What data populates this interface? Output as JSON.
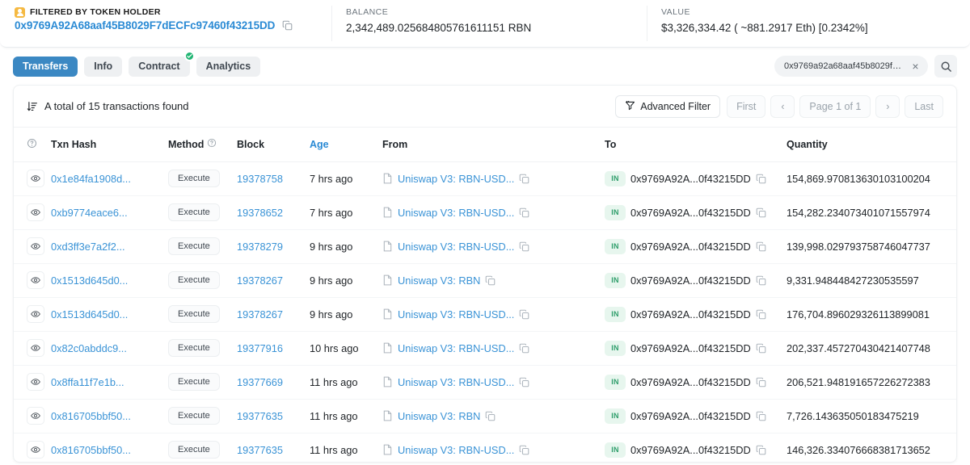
{
  "summary": {
    "filter": {
      "label": "FILTERED BY TOKEN HOLDER",
      "address": "0x9769A92A68aaf45B8029F7dECFc97460f43215DD",
      "copy_icon": "copy-icon",
      "tag_icon": "token-holder-icon"
    },
    "balance": {
      "label": "BALANCE",
      "value": "2,342,489.025684805761611151 RBN"
    },
    "value": {
      "label": "VALUE",
      "value": "$3,326,334.42 ( ~881.2917 Eth) [0.2342%]"
    }
  },
  "tabs": [
    {
      "label": "Transfers",
      "active": true,
      "verified": false
    },
    {
      "label": "Info",
      "active": false,
      "verified": false
    },
    {
      "label": "Contract",
      "active": false,
      "verified": true
    },
    {
      "label": "Analytics",
      "active": false,
      "verified": false
    }
  ],
  "search": {
    "value": "0x9769a92a68aaf45b8029f7d...",
    "placeholder": "Search",
    "clear_label": "×",
    "clear_icon": "close-icon",
    "search_icon": "search-icon"
  },
  "toolbar": {
    "total_text": "A total of 15 transactions found",
    "sort_icon": "sort-descending-icon",
    "advanced_filter_label": "Advanced Filter",
    "filter_icon": "funnel-icon",
    "pager": {
      "first": "First",
      "prev": "‹",
      "page": "Page 1 of 1",
      "next": "›",
      "last": "Last"
    }
  },
  "table": {
    "columns": {
      "eye": "",
      "eye_help_icon": "question-circle-icon",
      "hash": "Txn Hash",
      "method": "Method",
      "method_help_icon": "question-circle-icon",
      "block": "Block",
      "age": "Age",
      "from": "From",
      "to": "To",
      "quantity": "Quantity"
    },
    "rows": [
      {
        "eye_icon": "eye-icon",
        "hash": "0x1e84fa1908d...",
        "method": "Execute",
        "block": "19378758",
        "age": "7 hrs ago",
        "from": "Uniswap V3: RBN-USD...",
        "from_icon": "contract-icon",
        "from_copy_icon": "copy-icon",
        "direction": "IN",
        "to": "0x9769A92A...0f43215DD",
        "to_copy_icon": "copy-icon",
        "quantity": "154,869.970813630103100204"
      },
      {
        "eye_icon": "eye-icon",
        "hash": "0xb9774eace6...",
        "method": "Execute",
        "block": "19378652",
        "age": "7 hrs ago",
        "from": "Uniswap V3: RBN-USD...",
        "from_icon": "contract-icon",
        "from_copy_icon": "copy-icon",
        "direction": "IN",
        "to": "0x9769A92A...0f43215DD",
        "to_copy_icon": "copy-icon",
        "quantity": "154,282.234073401071557974"
      },
      {
        "eye_icon": "eye-icon",
        "hash": "0xd3ff3e7a2f2...",
        "method": "Execute",
        "block": "19378279",
        "age": "9 hrs ago",
        "from": "Uniswap V3: RBN-USD...",
        "from_icon": "contract-icon",
        "from_copy_icon": "copy-icon",
        "direction": "IN",
        "to": "0x9769A92A...0f43215DD",
        "to_copy_icon": "copy-icon",
        "quantity": "139,998.029793758746047737"
      },
      {
        "eye_icon": "eye-icon",
        "hash": "0x1513d645d0...",
        "method": "Execute",
        "block": "19378267",
        "age": "9 hrs ago",
        "from": "Uniswap V3: RBN",
        "from_icon": "contract-icon",
        "from_copy_icon": "copy-icon",
        "direction": "IN",
        "to": "0x9769A92A...0f43215DD",
        "to_copy_icon": "copy-icon",
        "quantity": "9,331.948448427230535597"
      },
      {
        "eye_icon": "eye-icon",
        "hash": "0x1513d645d0...",
        "method": "Execute",
        "block": "19378267",
        "age": "9 hrs ago",
        "from": "Uniswap V3: RBN-USD...",
        "from_icon": "contract-icon",
        "from_copy_icon": "copy-icon",
        "direction": "IN",
        "to": "0x9769A92A...0f43215DD",
        "to_copy_icon": "copy-icon",
        "quantity": "176,704.896029326113899081"
      },
      {
        "eye_icon": "eye-icon",
        "hash": "0x82c0abddc9...",
        "method": "Execute",
        "block": "19377916",
        "age": "10 hrs ago",
        "from": "Uniswap V3: RBN-USD...",
        "from_icon": "contract-icon",
        "from_copy_icon": "copy-icon",
        "direction": "IN",
        "to": "0x9769A92A...0f43215DD",
        "to_copy_icon": "copy-icon",
        "quantity": "202,337.457270430421407748"
      },
      {
        "eye_icon": "eye-icon",
        "hash": "0x8ffa11f7e1b...",
        "method": "Execute",
        "block": "19377669",
        "age": "11 hrs ago",
        "from": "Uniswap V3: RBN-USD...",
        "from_icon": "contract-icon",
        "from_copy_icon": "copy-icon",
        "direction": "IN",
        "to": "0x9769A92A...0f43215DD",
        "to_copy_icon": "copy-icon",
        "quantity": "206,521.948191657226272383"
      },
      {
        "eye_icon": "eye-icon",
        "hash": "0x816705bbf50...",
        "method": "Execute",
        "block": "19377635",
        "age": "11 hrs ago",
        "from": "Uniswap V3: RBN",
        "from_icon": "contract-icon",
        "from_copy_icon": "copy-icon",
        "direction": "IN",
        "to": "0x9769A92A...0f43215DD",
        "to_copy_icon": "copy-icon",
        "quantity": "7,726.143635050183475219"
      },
      {
        "eye_icon": "eye-icon",
        "hash": "0x816705bbf50...",
        "method": "Execute",
        "block": "19377635",
        "age": "11 hrs ago",
        "from": "Uniswap V3: RBN-USD...",
        "from_icon": "contract-icon",
        "from_copy_icon": "copy-icon",
        "direction": "IN",
        "to": "0x9769A92A...0f43215DD",
        "to_copy_icon": "copy-icon",
        "quantity": "146,326.334076668381713652"
      }
    ]
  },
  "colors": {
    "accent_blue": "#3b88c3",
    "link_blue": "#3a93d6",
    "verified_green": "#21b573",
    "in_badge_green": "#2f9e6b",
    "token_tag_amber": "#f5b942"
  }
}
